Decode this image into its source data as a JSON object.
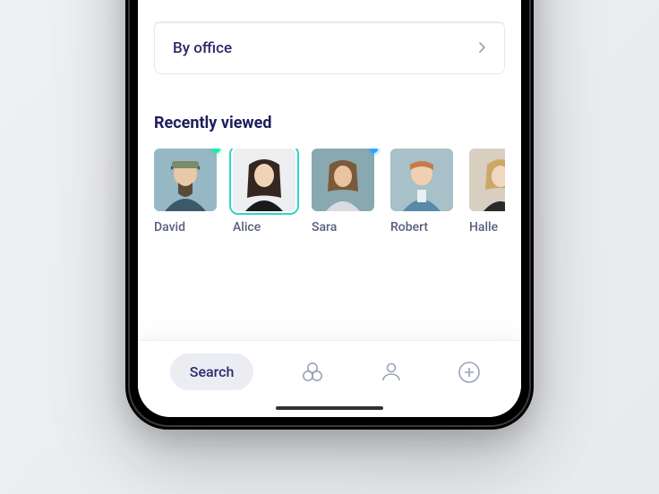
{
  "filters": {
    "by_office": {
      "label": "By office"
    }
  },
  "recent": {
    "title": "Recently viewed",
    "people": [
      {
        "name": "David",
        "status": "green",
        "selected": false
      },
      {
        "name": "Alice",
        "status": null,
        "selected": true
      },
      {
        "name": "Sara",
        "status": "blue",
        "selected": false
      },
      {
        "name": "Robert",
        "status": null,
        "selected": false
      },
      {
        "name": "Halle",
        "status": null,
        "selected": false
      }
    ]
  },
  "tabs": {
    "search": {
      "label": "Search"
    },
    "icons": [
      "circles-icon",
      "person-icon",
      "plus-icon"
    ]
  },
  "colors": {
    "accent": "#2fd6c4",
    "text_primary": "#1e1e5a",
    "status_green": "#25e8a7",
    "status_blue": "#2aa8ff"
  }
}
